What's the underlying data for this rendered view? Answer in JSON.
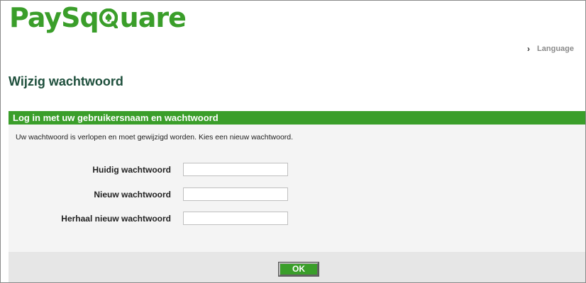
{
  "brand": {
    "logo_text_left": "PaySq",
    "logo_text_right": "uare",
    "logo_letter_icon": "spade-icon",
    "brand_color": "#3a9e2a"
  },
  "header": {
    "language_label": "Language",
    "language_icon": "chevron-right-icon"
  },
  "page": {
    "title": "Wijzig wachtwoord"
  },
  "panel": {
    "header": "Log in met uw gebruikersnaam en wachtwoord",
    "message": "Uw wachtwoord is verlopen en moet gewijzigd worden. Kies een nieuw wachtwoord.",
    "fields": [
      {
        "label": "Huidig wachtwoord",
        "value": "",
        "placeholder": ""
      },
      {
        "label": "Nieuw wachtwoord",
        "value": "",
        "placeholder": ""
      },
      {
        "label": "Herhaal nieuw wachtwoord",
        "value": "",
        "placeholder": ""
      }
    ],
    "ok_label": "OK"
  },
  "colors": {
    "title": "#1e4f3c",
    "panel_background": "#f4f4f4",
    "button_bar": "#e6e6e6"
  }
}
